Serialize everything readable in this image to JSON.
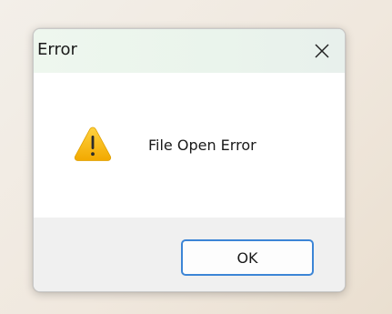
{
  "dialog": {
    "title": "Error",
    "close_icon": "close-icon",
    "warning_icon": "warning-icon",
    "message": "File Open Error",
    "ok_label": "OK",
    "accent_color": "#3c85d6",
    "warning_color": "#f5b400"
  }
}
